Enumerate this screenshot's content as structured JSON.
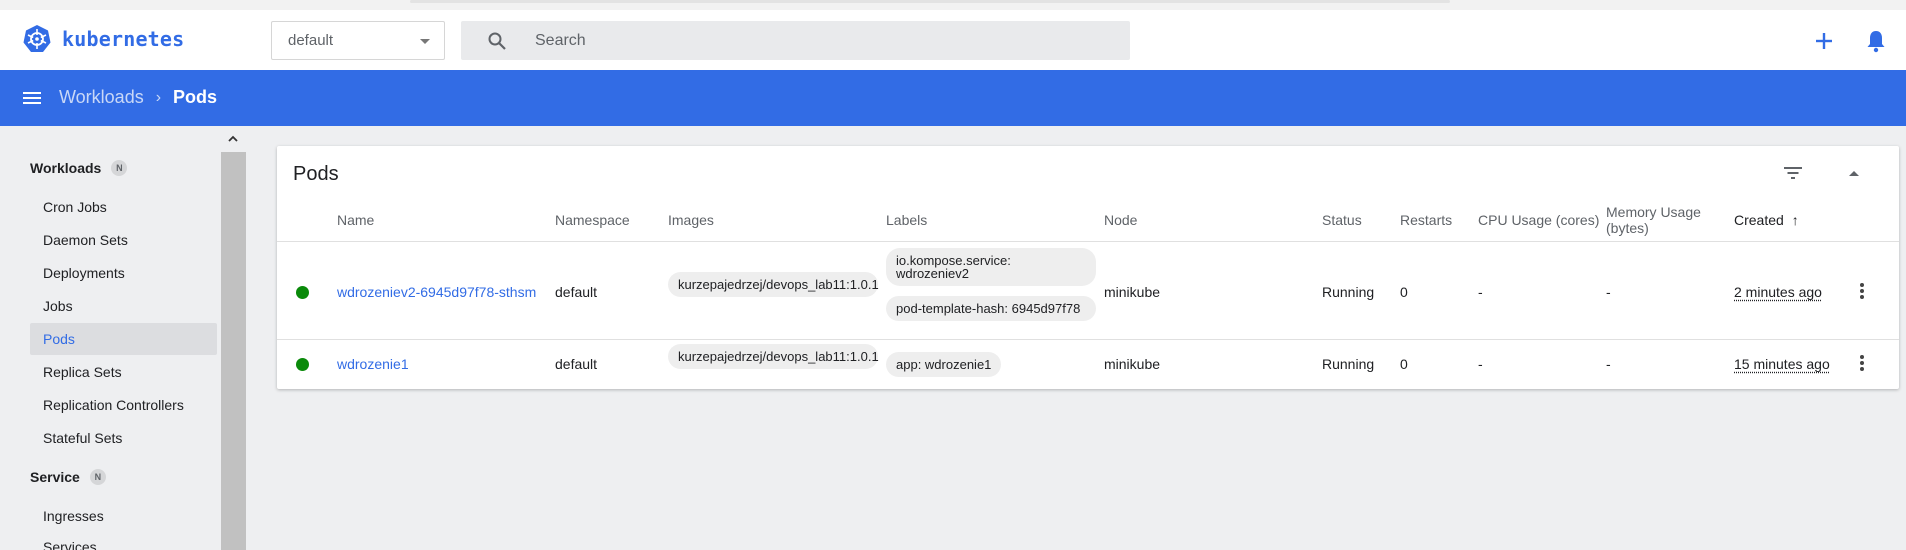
{
  "header": {
    "logo_text": "kubernetes",
    "namespace": "default",
    "search_placeholder": "Search",
    "icons": [
      "kubernetes-logo-icon",
      "search-icon",
      "plus-icon",
      "bell-icon"
    ]
  },
  "breadcrumb": {
    "parent": "Workloads",
    "current": "Pods"
  },
  "sidebar": {
    "groups": [
      {
        "label": "Workloads",
        "badge": "N"
      },
      {
        "label": "Service",
        "badge": "N"
      }
    ],
    "workload_items": [
      "Cron Jobs",
      "Daemon Sets",
      "Deployments",
      "Jobs",
      "Pods",
      "Replica Sets",
      "Replication Controllers",
      "Stateful Sets"
    ],
    "service_items": [
      "Ingresses",
      "Services"
    ],
    "active": "Pods"
  },
  "pods_card": {
    "title": "Pods",
    "columns": [
      "Name",
      "Namespace",
      "Images",
      "Labels",
      "Node",
      "Status",
      "Restarts",
      "CPU Usage (cores)",
      "Memory Usage (bytes)",
      "Created"
    ],
    "sort_indicator": "↑",
    "rows": [
      {
        "name": "wdrozeniev2-6945d97f78-sthsm",
        "namespace": "default",
        "image": "kurzepajedrzej/devops_lab11:1.0.1",
        "labels": [
          "io.kompose.service: wdrozeniev2",
          "pod-template-hash: 6945d97f78"
        ],
        "node": "minikube",
        "status": "Running",
        "restarts": "0",
        "cpu": "-",
        "memory": "-",
        "created": "2 minutes ago"
      },
      {
        "name": "wdrozenie1",
        "namespace": "default",
        "image": "kurzepajedrzej/devops_lab11:1.0.1",
        "labels": [
          "app: wdrozenie1"
        ],
        "node": "minikube",
        "status": "Running",
        "restarts": "0",
        "cpu": "-",
        "memory": "-",
        "created": "15 minutes ago"
      }
    ]
  },
  "colors": {
    "brand": "#326ce5",
    "status_running": "#0a8a0a"
  }
}
